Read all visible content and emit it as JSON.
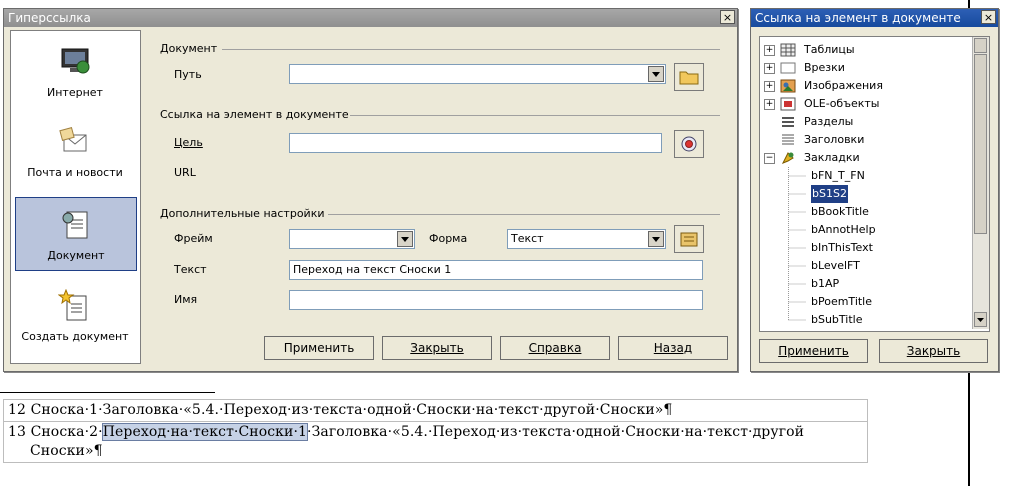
{
  "hyperlink_dialog": {
    "title": "Гиперссылка",
    "close_symbol": "×",
    "sidebar": [
      {
        "label": "Интернет",
        "icon": "globe-monitor-icon"
      },
      {
        "label": "Почта и новости",
        "icon": "mail-icon"
      },
      {
        "label": "Документ",
        "icon": "document-icon",
        "selected": true
      },
      {
        "label": "Создать документ",
        "icon": "new-document-icon"
      }
    ],
    "document_group": "Документ",
    "path_label": "Путь",
    "path_value": "",
    "target_group": "Ссылка на элемент в документе",
    "target_label": "Цель",
    "target_value": "",
    "url_label": "URL",
    "extra_group": "Дополнительные настройки",
    "frame_label": "Фрейм",
    "frame_value": "",
    "form_label": "Форма",
    "form_value": "Текст",
    "text_label": "Текст",
    "text_value": "Переход на текст Сноски 1",
    "name_label": "Имя",
    "name_value": "",
    "buttons": {
      "apply": "Применить",
      "close": "Закрыть",
      "help": "Справка",
      "back": "Назад"
    }
  },
  "target_dialog": {
    "title": "Ссылка на элемент в документе",
    "close_symbol": "×",
    "tree": [
      {
        "label": "Таблицы",
        "expander": "+"
      },
      {
        "label": "Врезки",
        "expander": "+"
      },
      {
        "label": "Изображения",
        "expander": "+"
      },
      {
        "label": "OLE-объекты",
        "expander": "+"
      },
      {
        "label": "Разделы",
        "expander": ""
      },
      {
        "label": "Заголовки",
        "expander": ""
      },
      {
        "label": "Закладки",
        "expander": "−"
      }
    ],
    "bookmarks": [
      "bFN_T_FN",
      "bS1S2",
      "bBookTitle",
      "bAnnotHelp",
      "bInThisText",
      "bLevelFT",
      "b1AP",
      "bPoemTitle",
      "bSubTitle"
    ],
    "selected_bookmark": "bS1S2",
    "buttons": {
      "apply": "Применить",
      "close": "Закрыть"
    }
  },
  "document": {
    "line12": "12 Сноска·1·Заголовка·«5.4.·Переход·из·текста·одной·Сноски·на·текст·другой·Сноски»¶",
    "line13_prefix": "13 Сноска·2·",
    "line13_highlight": "Переход·на·текст·Сноски·1",
    "line13_suffix": "·Заголовка·«5.4.·Переход·из·текста·одной·Сноски·на·текст·другой",
    "line13_cont": "Сноски»¶"
  },
  "colors": {
    "titlebar_active": "#1f4fa6",
    "titlebar_inactive": "#999999",
    "dialog_bg": "#ece9d8",
    "selection": "#1f3f86"
  }
}
